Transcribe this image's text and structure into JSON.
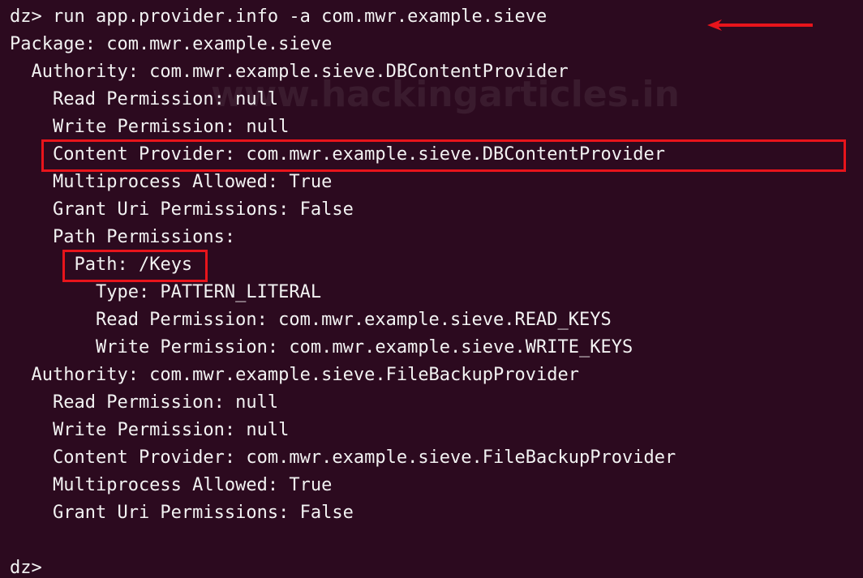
{
  "watermark": "www.hackingarticles.in",
  "lines": [
    "dz> run app.provider.info -a com.mwr.example.sieve",
    "Package: com.mwr.example.sieve",
    "  Authority: com.mwr.example.sieve.DBContentProvider",
    "    Read Permission: null",
    "    Write Permission: null",
    "Content Provider: com.mwr.example.sieve.DBContentProvider",
    "    Multiprocess Allowed: True",
    "    Grant Uri Permissions: False",
    "    Path Permissions:",
    "Path: /Keys",
    "        Type: PATTERN_LITERAL",
    "        Read Permission: com.mwr.example.sieve.READ_KEYS",
    "        Write Permission: com.mwr.example.sieve.WRITE_KEYS",
    "  Authority: com.mwr.example.sieve.FileBackupProvider",
    "    Read Permission: null",
    "    Write Permission: null",
    "    Content Provider: com.mwr.example.sieve.FileBackupProvider",
    "    Multiprocess Allowed: True",
    "    Grant Uri Permissions: False",
    "",
    "dz>"
  ],
  "colors": {
    "background": "#2c0a1f",
    "text": "#f2f2f2",
    "highlight": "#e8141b"
  }
}
